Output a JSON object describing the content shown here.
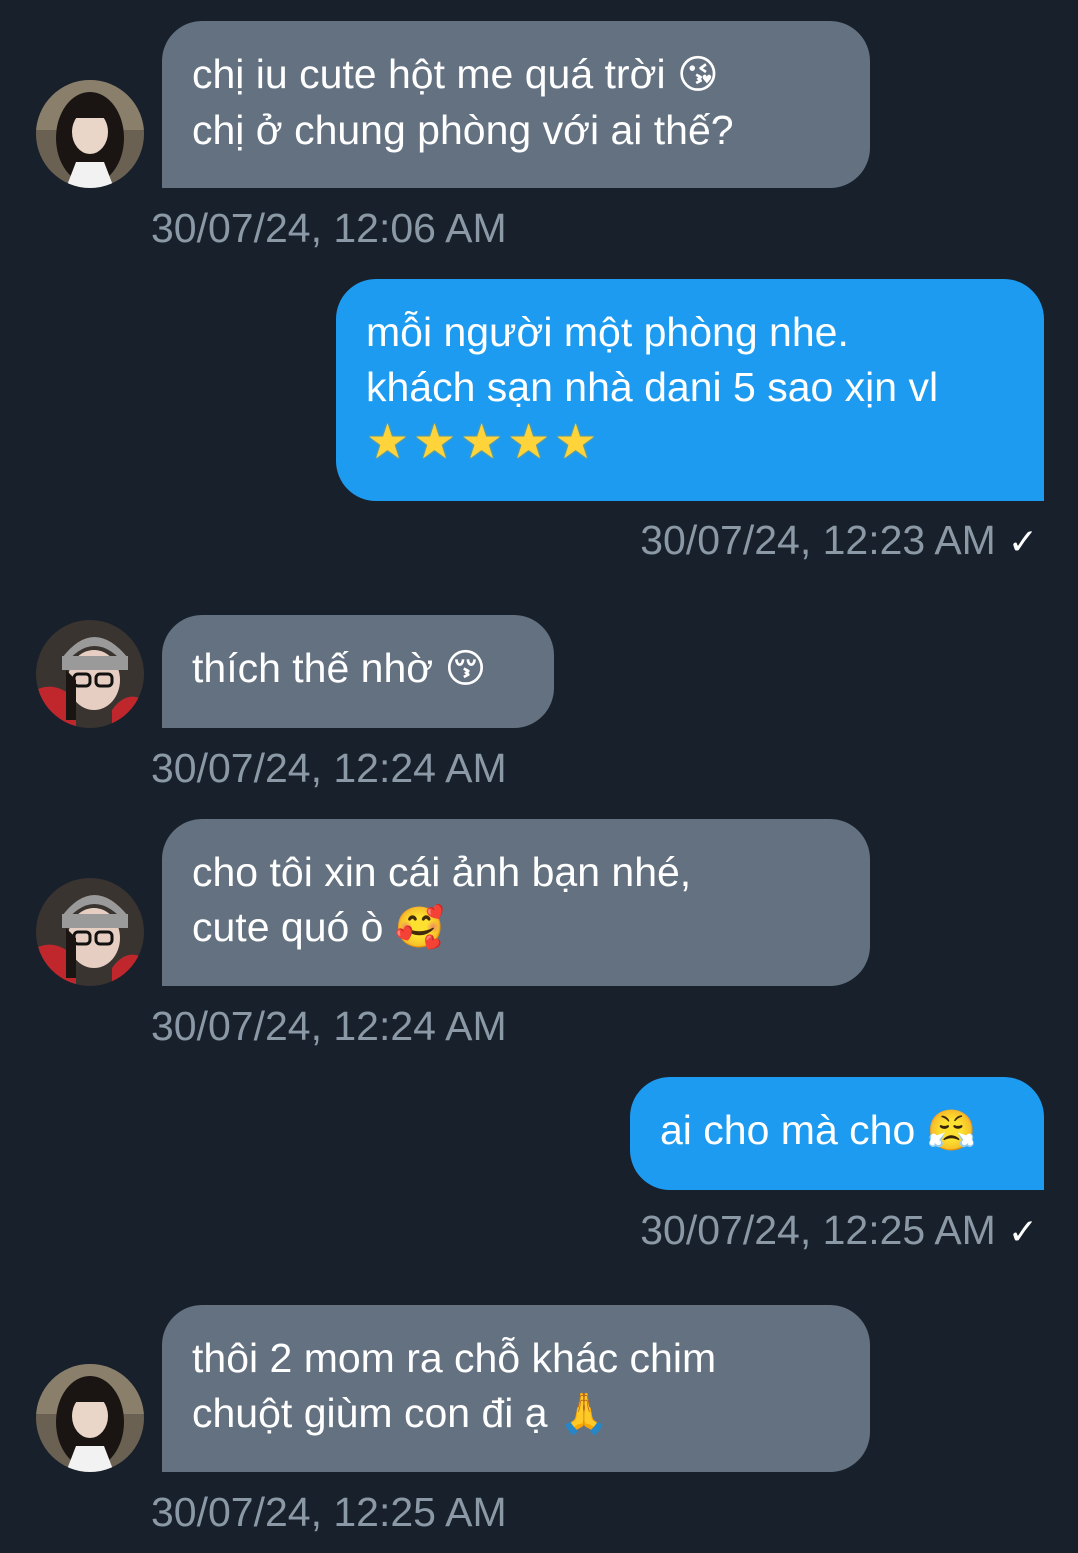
{
  "conversation": {
    "messages": [
      {
        "direction": "incoming",
        "lines": [
          "chị iu cute hột me quá trời",
          "chị ở chung phòng với ai thế?"
        ],
        "emoji": "😘",
        "timestamp": "30/07/24, 12:06 AM",
        "avatar": "avatar-long-hair"
      },
      {
        "direction": "outgoing",
        "lines": [
          "mỗi người một phòng nhe.",
          "khách sạn nhà dani 5 sao xịn vl"
        ],
        "stars": "★★★★★",
        "timestamp": "30/07/24, 12:23 AM",
        "status_icon": "✓"
      },
      {
        "direction": "incoming",
        "lines": [
          "thích thế nhờ"
        ],
        "emoji": "😚",
        "timestamp": "30/07/24, 12:24 AM",
        "avatar": "avatar-beanie-glasses"
      },
      {
        "direction": "incoming",
        "lines": [
          "cho tôi xin cái ảnh bạn nhé,",
          "cute quó ò"
        ],
        "emoji": "🥰",
        "timestamp": "30/07/24, 12:24 AM",
        "avatar": "avatar-beanie-glasses"
      },
      {
        "direction": "outgoing",
        "lines": [
          "ai cho mà cho"
        ],
        "emoji": "😤",
        "timestamp": "30/07/24, 12:25 AM",
        "status_icon": "✓"
      },
      {
        "direction": "incoming",
        "lines": [
          "thôi 2 mom ra chỗ khác chim",
          "chuột giùm con đi ạ"
        ],
        "emoji": "🙏",
        "timestamp": "30/07/24, 12:25 AM",
        "avatar": "avatar-long-hair"
      }
    ]
  },
  "colors": {
    "background": "#17202b",
    "incoming_bubble": "#637180",
    "outgoing_bubble": "#1d9bf0",
    "timestamp": "#8b98a5"
  }
}
